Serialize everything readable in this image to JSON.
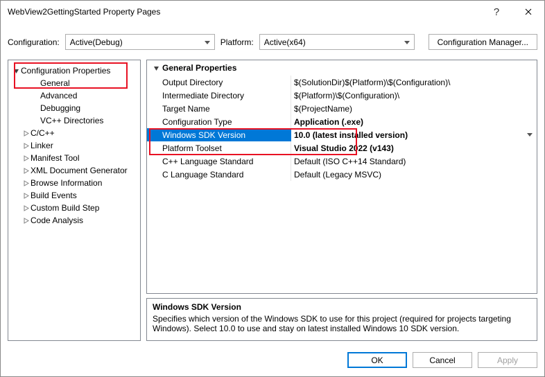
{
  "title": "WebView2GettingStarted Property Pages",
  "toolbar": {
    "configLabel": "Configuration:",
    "configValue": "Active(Debug)",
    "platformLabel": "Platform:",
    "platformValue": "Active(x64)",
    "cfgMgrLabel": "Configuration Manager..."
  },
  "tree": {
    "root": "Configuration Properties",
    "items": [
      {
        "label": "General",
        "leaf": true
      },
      {
        "label": "Advanced",
        "leaf": true
      },
      {
        "label": "Debugging",
        "leaf": true
      },
      {
        "label": "VC++ Directories",
        "leaf": true
      },
      {
        "label": "C/C++",
        "leaf": false
      },
      {
        "label": "Linker",
        "leaf": false
      },
      {
        "label": "Manifest Tool",
        "leaf": false
      },
      {
        "label": "XML Document Generator",
        "leaf": false
      },
      {
        "label": "Browse Information",
        "leaf": false
      },
      {
        "label": "Build Events",
        "leaf": false
      },
      {
        "label": "Custom Build Step",
        "leaf": false
      },
      {
        "label": "Code Analysis",
        "leaf": false
      }
    ]
  },
  "grid": {
    "header": "General Properties",
    "rows": [
      {
        "key": "Output Directory",
        "val": "$(SolutionDir)$(Platform)\\$(Configuration)\\",
        "bold": false,
        "sel": false,
        "boxed": false
      },
      {
        "key": "Intermediate Directory",
        "val": "$(Platform)\\$(Configuration)\\",
        "bold": false,
        "sel": false,
        "boxed": false
      },
      {
        "key": "Target Name",
        "val": "$(ProjectName)",
        "bold": false,
        "sel": false,
        "boxed": false
      },
      {
        "key": "Configuration Type",
        "val": "Application (.exe)",
        "bold": true,
        "sel": false,
        "boxed": false
      },
      {
        "key": "Windows SDK Version",
        "val": "10.0 (latest installed version)",
        "bold": true,
        "sel": true,
        "boxed": true
      },
      {
        "key": "Platform Toolset",
        "val": "Visual Studio 2022 (v143)",
        "bold": true,
        "sel": false,
        "boxed": true
      },
      {
        "key": "C++ Language Standard",
        "val": "Default (ISO C++14 Standard)",
        "bold": false,
        "sel": false,
        "boxed": false
      },
      {
        "key": "C Language Standard",
        "val": "Default (Legacy MSVC)",
        "bold": false,
        "sel": false,
        "boxed": false
      }
    ]
  },
  "desc": {
    "title": "Windows SDK Version",
    "text": "Specifies which version of the Windows SDK to use for this project (required for projects targeting Windows). Select 10.0 to use and stay on latest installed Windows 10 SDK version."
  },
  "footer": {
    "ok": "OK",
    "cancel": "Cancel",
    "apply": "Apply"
  }
}
